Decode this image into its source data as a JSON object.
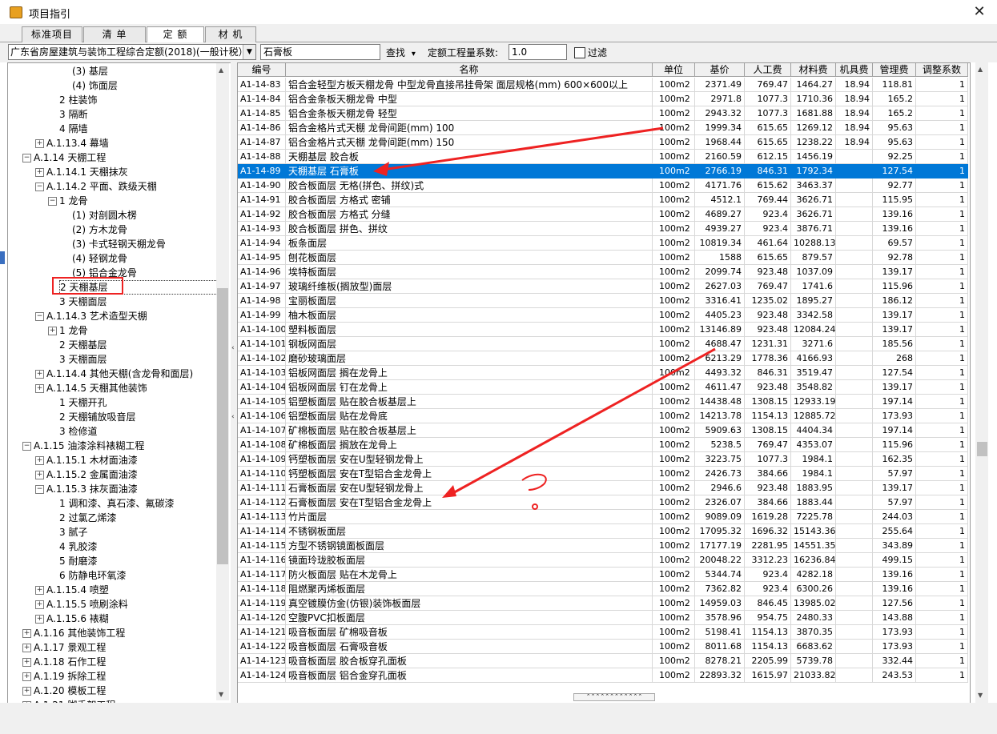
{
  "window": {
    "title": "项目指引",
    "close_glyph": "✕"
  },
  "tabs": [
    {
      "label": "标准项目"
    },
    {
      "label": "清 单"
    },
    {
      "label": "定 额",
      "active": true
    },
    {
      "label": "材 机"
    }
  ],
  "toolbar": {
    "quota_library": "广东省房屋建筑与装饰工程综合定额(2018)(一般计税）",
    "search_value": "石膏板",
    "find_label": "查找",
    "find_arrow": "▾",
    "coef_label": "定额工程量系数:",
    "coef_value": "1.0",
    "filter_label": "过滤"
  },
  "tree": [
    {
      "label": "(3) 基层",
      "plus": false
    },
    {
      "label": "(4) 饰面层",
      "plus": false
    },
    {
      "label": "2 柱装饰",
      "plus": false
    },
    {
      "label": "3 隔断",
      "plus": false
    },
    {
      "label": "4 隔墙",
      "plus": false
    },
    {
      "label": "A.1.13.4 幕墙",
      "plus": true
    },
    {
      "label": "A.1.14 天棚工程",
      "plus": true
    },
    {
      "label": "A.1.14.1 天棚抹灰",
      "plus": true
    },
    {
      "label": "A.1.14.2 平面、跌级天棚",
      "plus": true
    },
    {
      "label": "1 龙骨",
      "plus": true
    },
    {
      "label": "(1) 对剖圆木楞",
      "plus": false
    },
    {
      "label": "(2) 方木龙骨",
      "plus": false
    },
    {
      "label": "(3) 卡式轻钢天棚龙骨",
      "plus": false
    },
    {
      "label": "(4) 轻钢龙骨",
      "plus": false
    },
    {
      "label": "(5) 铝合金龙骨",
      "plus": false
    },
    {
      "label": "2 天棚基层",
      "plus": false,
      "selected": true
    },
    {
      "label": "3 天棚面层",
      "plus": false
    },
    {
      "label": "A.1.14.3 艺术造型天棚",
      "plus": true
    },
    {
      "label": "1 龙骨",
      "plus": true
    },
    {
      "label": "2 天棚基层",
      "plus": false
    },
    {
      "label": "3 天棚面层",
      "plus": false
    },
    {
      "label": "A.1.14.4 其他天棚(含龙骨和面层)",
      "plus": true
    },
    {
      "label": "A.1.14.5 天棚其他装饰",
      "plus": true
    },
    {
      "label": "1 天棚开孔",
      "plus": false
    },
    {
      "label": "2 天棚铺放吸音层",
      "plus": false
    },
    {
      "label": "3 检修道",
      "plus": false
    },
    {
      "label": "A.1.15 油漆涂料裱糊工程",
      "plus": true
    },
    {
      "label": "A.1.15.1 木材面油漆",
      "plus": true
    },
    {
      "label": "A.1.15.2 金属面油漆",
      "plus": true
    },
    {
      "label": "A.1.15.3 抹灰面油漆",
      "plus": true
    },
    {
      "label": "1 调和漆、真石漆、氟碳漆",
      "plus": false
    },
    {
      "label": "2 过氯乙烯漆",
      "plus": false
    },
    {
      "label": "3 腻子",
      "plus": false
    },
    {
      "label": "4 乳胶漆",
      "plus": false
    },
    {
      "label": "5 耐磨漆",
      "plus": false
    },
    {
      "label": "6 防静电环氧漆",
      "plus": false
    },
    {
      "label": "A.1.15.4 喷塑",
      "plus": true
    },
    {
      "label": "A.1.15.5 喷刷涂料",
      "plus": true
    },
    {
      "label": "A.1.15.6 裱糊",
      "plus": true
    },
    {
      "label": "A.1.16 其他装饰工程",
      "plus": true
    },
    {
      "label": "A.1.17 景观工程",
      "plus": true
    },
    {
      "label": "A.1.18 石作工程",
      "plus": true
    },
    {
      "label": "A.1.19 拆除工程",
      "plus": true
    },
    {
      "label": "A.1.20 模板工程",
      "plus": true
    },
    {
      "label": "A.1.21 脚手架工程",
      "plus": true
    }
  ],
  "grid": {
    "headers": [
      "编号",
      "名称",
      "单位",
      "基价",
      "人工费",
      "材料费",
      "机具费",
      "管理费",
      "调整系数"
    ],
    "rows": [
      [
        "A1-14-83",
        "铝合金轻型方板天棚龙骨 中型龙骨直接吊挂骨架 面层规格(mm) 600×600以上",
        "100m2",
        "2371.49",
        "769.47",
        "1464.27",
        "18.94",
        "118.81",
        "1"
      ],
      [
        "A1-14-84",
        "铝合金条板天棚龙骨 中型",
        "100m2",
        "2971.8",
        "1077.3",
        "1710.36",
        "18.94",
        "165.2",
        "1"
      ],
      [
        "A1-14-85",
        "铝合金条板天棚龙骨 轻型",
        "100m2",
        "2943.32",
        "1077.3",
        "1681.88",
        "18.94",
        "165.2",
        "1"
      ],
      [
        "A1-14-86",
        "铝合金格片式天棚 龙骨间距(mm) 100",
        "100m2",
        "1999.34",
        "615.65",
        "1269.12",
        "18.94",
        "95.63",
        "1"
      ],
      [
        "A1-14-87",
        "铝合金格片式天棚 龙骨间距(mm) 150",
        "100m2",
        "1968.44",
        "615.65",
        "1238.22",
        "18.94",
        "95.63",
        "1"
      ],
      [
        "A1-14-88",
        "天棚基层 胶合板",
        "100m2",
        "2160.59",
        "612.15",
        "1456.19",
        "",
        "92.25",
        "1"
      ],
      [
        "A1-14-89",
        "天棚基层 石膏板",
        "100m2",
        "2766.19",
        "846.31",
        "1792.34",
        "",
        "127.54",
        "1"
      ],
      [
        "A1-14-90",
        "胶合板面层 无格(拼色、拼纹)式",
        "100m2",
        "4171.76",
        "615.62",
        "3463.37",
        "",
        "92.77",
        "1"
      ],
      [
        "A1-14-91",
        "胶合板面层 方格式 密铺",
        "100m2",
        "4512.1",
        "769.44",
        "3626.71",
        "",
        "115.95",
        "1"
      ],
      [
        "A1-14-92",
        "胶合板面层 方格式 分缝",
        "100m2",
        "4689.27",
        "923.4",
        "3626.71",
        "",
        "139.16",
        "1"
      ],
      [
        "A1-14-93",
        "胶合板面层 拼色、拼纹",
        "100m2",
        "4939.27",
        "923.4",
        "3876.71",
        "",
        "139.16",
        "1"
      ],
      [
        "A1-14-94",
        "板条面层",
        "100m2",
        "10819.34",
        "461.64",
        "10288.13",
        "",
        "69.57",
        "1"
      ],
      [
        "A1-14-95",
        "刨花板面层",
        "100m2",
        "1588",
        "615.65",
        "879.57",
        "",
        "92.78",
        "1"
      ],
      [
        "A1-14-96",
        "埃特板面层",
        "100m2",
        "2099.74",
        "923.48",
        "1037.09",
        "",
        "139.17",
        "1"
      ],
      [
        "A1-14-97",
        "玻璃纤维板(搁放型)面层",
        "100m2",
        "2627.03",
        "769.47",
        "1741.6",
        "",
        "115.96",
        "1"
      ],
      [
        "A1-14-98",
        "宝丽板面层",
        "100m2",
        "3316.41",
        "1235.02",
        "1895.27",
        "",
        "186.12",
        "1"
      ],
      [
        "A1-14-99",
        "柚木板面层",
        "100m2",
        "4405.23",
        "923.48",
        "3342.58",
        "",
        "139.17",
        "1"
      ],
      [
        "A1-14-100",
        "塑料板面层",
        "100m2",
        "13146.89",
        "923.48",
        "12084.24",
        "",
        "139.17",
        "1"
      ],
      [
        "A1-14-101",
        "钢板网面层",
        "100m2",
        "4688.47",
        "1231.31",
        "3271.6",
        "",
        "185.56",
        "1"
      ],
      [
        "A1-14-102",
        "磨砂玻璃面层",
        "100m2",
        "6213.29",
        "1778.36",
        "4166.93",
        "",
        "268",
        "1"
      ],
      [
        "A1-14-103",
        "铝板网面层 搁在龙骨上",
        "100m2",
        "4493.32",
        "846.31",
        "3519.47",
        "",
        "127.54",
        "1"
      ],
      [
        "A1-14-104",
        "铝板网面层 钉在龙骨上",
        "100m2",
        "4611.47",
        "923.48",
        "3548.82",
        "",
        "139.17",
        "1"
      ],
      [
        "A1-14-105",
        "铝塑板面层 贴在胶合板基层上",
        "100m2",
        "14438.48",
        "1308.15",
        "12933.19",
        "",
        "197.14",
        "1"
      ],
      [
        "A1-14-106",
        "铝塑板面层 贴在龙骨底",
        "100m2",
        "14213.78",
        "1154.13",
        "12885.72",
        "",
        "173.93",
        "1"
      ],
      [
        "A1-14-107",
        "矿棉板面层 贴在胶合板基层上",
        "100m2",
        "5909.63",
        "1308.15",
        "4404.34",
        "",
        "197.14",
        "1"
      ],
      [
        "A1-14-108",
        "矿棉板面层 搁放在龙骨上",
        "100m2",
        "5238.5",
        "769.47",
        "4353.07",
        "",
        "115.96",
        "1"
      ],
      [
        "A1-14-109",
        "钙塑板面层 安在U型轻钢龙骨上",
        "100m2",
        "3223.75",
        "1077.3",
        "1984.1",
        "",
        "162.35",
        "1"
      ],
      [
        "A1-14-110",
        "钙塑板面层 安在T型铝合金龙骨上",
        "100m2",
        "2426.73",
        "384.66",
        "1984.1",
        "",
        "57.97",
        "1"
      ],
      [
        "A1-14-111",
        "石膏板面层 安在U型轻钢龙骨上",
        "100m2",
        "2946.6",
        "923.48",
        "1883.95",
        "",
        "139.17",
        "1"
      ],
      [
        "A1-14-112",
        "石膏板面层 安在T型铝合金龙骨上",
        "100m2",
        "2326.07",
        "384.66",
        "1883.44",
        "",
        "57.97",
        "1"
      ],
      [
        "A1-14-113",
        "竹片面层",
        "100m2",
        "9089.09",
        "1619.28",
        "7225.78",
        "",
        "244.03",
        "1"
      ],
      [
        "A1-14-114",
        "不锈钢板面层",
        "100m2",
        "17095.32",
        "1696.32",
        "15143.36",
        "",
        "255.64",
        "1"
      ],
      [
        "A1-14-115",
        "方型不锈钢镜面板面层",
        "100m2",
        "17177.19",
        "2281.95",
        "14551.35",
        "",
        "343.89",
        "1"
      ],
      [
        "A1-14-116",
        "镜面玲珑胶板面层",
        "100m2",
        "20048.22",
        "3312.23",
        "16236.84",
        "",
        "499.15",
        "1"
      ],
      [
        "A1-14-117",
        "防火板面层 贴在木龙骨上",
        "100m2",
        "5344.74",
        "923.4",
        "4282.18",
        "",
        "139.16",
        "1"
      ],
      [
        "A1-14-118",
        "阻燃聚丙烯板面层",
        "100m2",
        "7362.82",
        "923.4",
        "6300.26",
        "",
        "139.16",
        "1"
      ],
      [
        "A1-14-119",
        "真空镀膜仿金(仿银)装饰板面层",
        "100m2",
        "14959.03",
        "846.45",
        "13985.02",
        "",
        "127.56",
        "1"
      ],
      [
        "A1-14-120",
        "空腹PVC扣板面层",
        "100m2",
        "3578.96",
        "954.75",
        "2480.33",
        "",
        "143.88",
        "1"
      ],
      [
        "A1-14-121",
        "吸音板面层 矿棉吸音板",
        "100m2",
        "5198.41",
        "1154.13",
        "3870.35",
        "",
        "173.93",
        "1"
      ],
      [
        "A1-14-122",
        "吸音板面层 石膏吸音板",
        "100m2",
        "8011.68",
        "1154.13",
        "6683.62",
        "",
        "173.93",
        "1"
      ],
      [
        "A1-14-123",
        "吸音板面层 胶合板穿孔面板",
        "100m2",
        "8278.21",
        "2205.99",
        "5739.78",
        "",
        "332.44",
        "1"
      ],
      [
        "A1-14-124",
        "吸音板面层 铝合金穿孔面板",
        "100m2",
        "22893.32",
        "1615.97",
        "21033.82",
        "",
        "243.53",
        "1"
      ]
    ],
    "selected_row": 6
  },
  "colors": {
    "selection": "#0078d7",
    "annotation": "#ee2222"
  }
}
